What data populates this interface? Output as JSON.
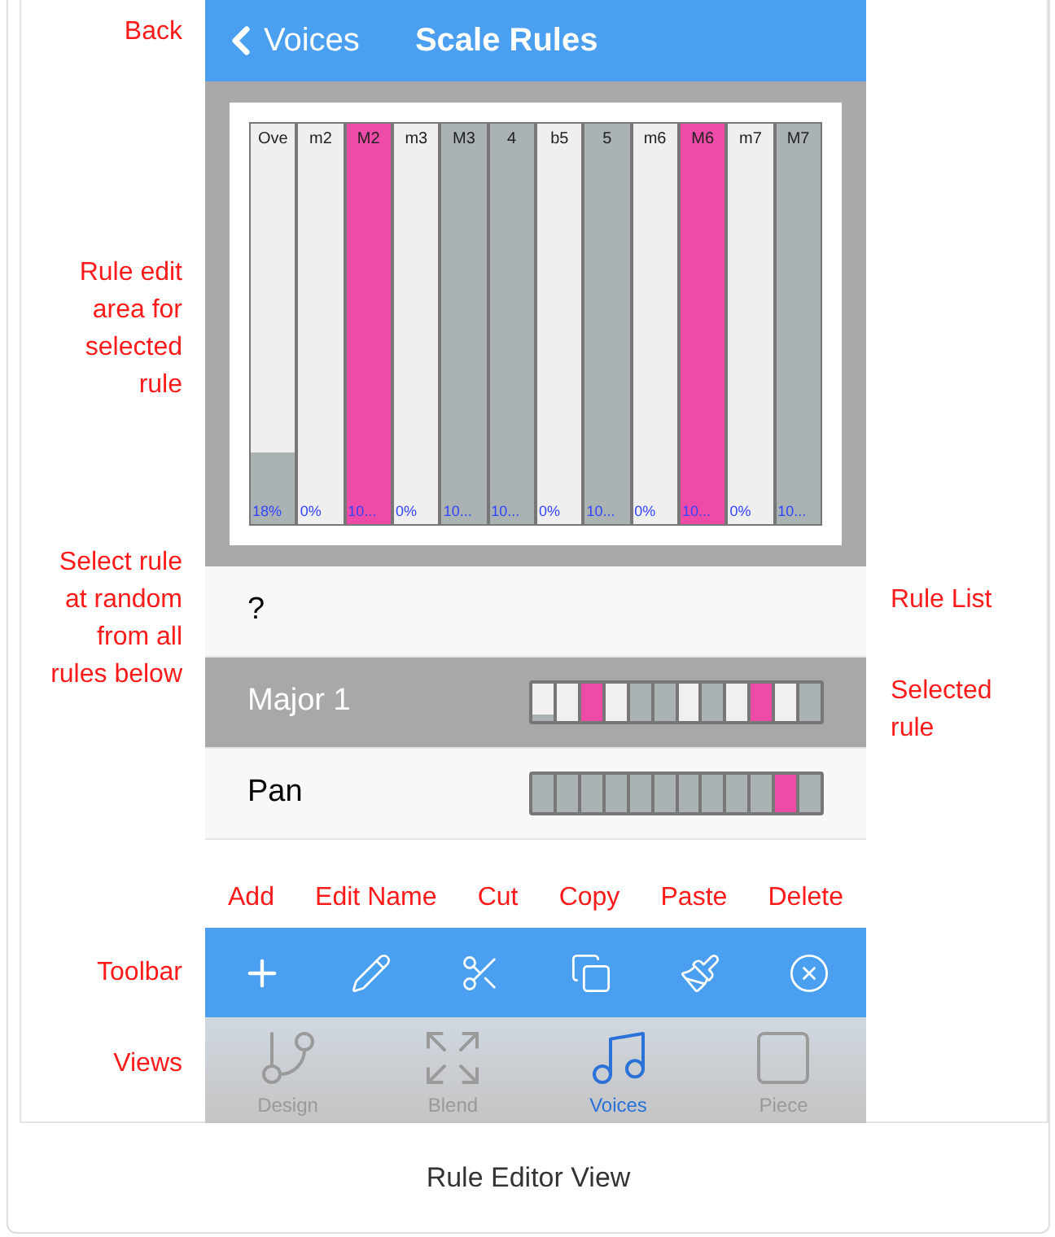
{
  "annotations_left": [
    "Back",
    "Rule edit\narea for\nselected\nrule",
    "Select rule\nat random\nfrom all\nrules below",
    "Toolbar",
    "Views"
  ],
  "annotations_right": [
    "Rule List",
    "Selected\nrule"
  ],
  "nav": {
    "back": "Voices",
    "title": "Scale Rules"
  },
  "editor": {
    "columns": [
      {
        "label": "Ove",
        "value": "18%",
        "level": 0.18,
        "highlighted": false
      },
      {
        "label": "m2",
        "value": "0%",
        "level": 0
      },
      {
        "label": "M2",
        "value": "10...",
        "level": 1,
        "highlighted": true
      },
      {
        "label": "m3",
        "value": "0%",
        "level": 0
      },
      {
        "label": "M3",
        "value": "10...",
        "level": 1,
        "highlighted": false
      },
      {
        "label": "4",
        "value": "10...",
        "level": 1,
        "highlighted": false
      },
      {
        "label": "b5",
        "value": "0%",
        "level": 0
      },
      {
        "label": "5",
        "value": "10...",
        "level": 1,
        "highlighted": false
      },
      {
        "label": "m6",
        "value": "0%",
        "level": 0
      },
      {
        "label": "M6",
        "value": "10...",
        "level": 1,
        "highlighted": true
      },
      {
        "label": "m7",
        "value": "0%",
        "level": 0
      },
      {
        "label": "M7",
        "value": "10...",
        "level": 1,
        "highlighted": false
      }
    ]
  },
  "rules": [
    {
      "name": "?",
      "selected": false
    },
    {
      "name": "Major 1",
      "selected": true,
      "pattern": [
        {
          "level": 0.18,
          "highlighted": false
        },
        {
          "level": 0
        },
        {
          "level": 1,
          "highlighted": true
        },
        {
          "level": 0
        },
        {
          "level": 1,
          "highlighted": false
        },
        {
          "level": 1,
          "highlighted": false
        },
        {
          "level": 0
        },
        {
          "level": 1,
          "highlighted": false
        },
        {
          "level": 0
        },
        {
          "level": 1,
          "highlighted": true
        },
        {
          "level": 0
        },
        {
          "level": 1,
          "highlighted": false
        }
      ]
    },
    {
      "name": "Pan",
      "selected": false,
      "pattern": [
        {
          "level": 1,
          "highlighted": false
        },
        {
          "level": 1,
          "highlighted": false
        },
        {
          "level": 1,
          "highlighted": false
        },
        {
          "level": 1,
          "highlighted": false
        },
        {
          "level": 1,
          "highlighted": false
        },
        {
          "level": 1,
          "highlighted": false
        },
        {
          "level": 1,
          "highlighted": false
        },
        {
          "level": 1,
          "highlighted": false
        },
        {
          "level": 1,
          "highlighted": false
        },
        {
          "level": 1,
          "highlighted": false
        },
        {
          "level": 1,
          "highlighted": true
        },
        {
          "level": 1,
          "highlighted": false
        }
      ]
    }
  ],
  "toolbar_labels": [
    "Add",
    "Edit Name",
    "Cut",
    "Copy",
    "Paste",
    "Delete"
  ],
  "tabs": [
    {
      "label": "Design",
      "selected": false
    },
    {
      "label": "Blend",
      "selected": false
    },
    {
      "label": "Voices",
      "selected": true
    },
    {
      "label": "Piece",
      "selected": false
    }
  ],
  "caption": "Rule Editor View"
}
